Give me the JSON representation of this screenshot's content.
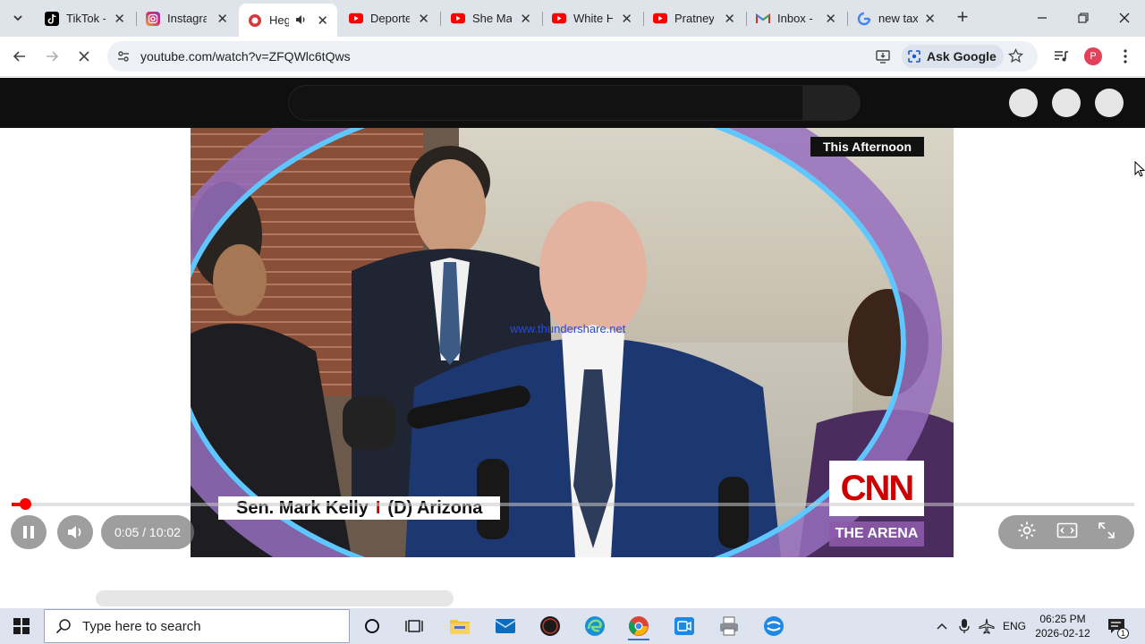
{
  "browser": {
    "tabs": [
      {
        "title": "TikTok -",
        "icon": "tiktok-icon"
      },
      {
        "title": "Instagra",
        "icon": "instagram-icon"
      },
      {
        "title": "Heg",
        "icon": "youtube-icon",
        "active": true,
        "audio": true
      },
      {
        "title": "Deporte",
        "icon": "youtube-icon"
      },
      {
        "title": "She Ma",
        "icon": "youtube-icon"
      },
      {
        "title": "White H",
        "icon": "youtube-icon"
      },
      {
        "title": "Pratney",
        "icon": "youtube-icon"
      },
      {
        "title": "Inbox -",
        "icon": "gmail-icon"
      },
      {
        "title": "new tax",
        "icon": "google-icon"
      }
    ],
    "url": "youtube.com/watch?v=ZFQWlc6tQws",
    "ask_google": "Ask Google",
    "profile_initial": "P"
  },
  "video": {
    "bug_text": "This Afternoon",
    "lower_third_name": "Sen. Mark Kelly",
    "lower_third_sep": "I",
    "lower_third_party": "(D) Arizona",
    "network": "CNN",
    "show": "THE ARENA",
    "watermark": "www.thundershare.net",
    "time_display": "0:05 / 10:02",
    "progress_fraction": 0.008
  },
  "taskbar": {
    "search_placeholder": "Type here to search",
    "language": "ENG",
    "time": "06:25 PM",
    "date": "2026-02-12",
    "notification_count": "1"
  },
  "colors": {
    "youtube_red": "#ff0000",
    "cnn_red": "#cc0000",
    "tab_strip": "#dfe3ea",
    "taskbar": "#dde4ef"
  }
}
